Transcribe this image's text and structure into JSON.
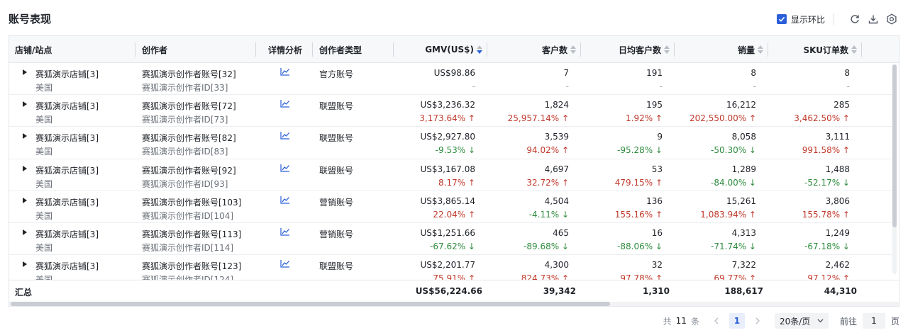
{
  "title": "账号表现",
  "toolbar": {
    "compare_label": "显示环比",
    "compare_checked": true,
    "icons": [
      "refresh-icon",
      "download-icon",
      "settings-icon"
    ]
  },
  "columns": {
    "shop": "店铺/站点",
    "creator": "创作者",
    "detail": "详情分析",
    "type": "创作者类型",
    "gmv": "GMV(US$)",
    "customers": "客户数",
    "daily": "日均客户数",
    "sales": "销量",
    "sku": "SKU订单数"
  },
  "rows": [
    {
      "shop": "赛狐演示店铺[3]",
      "site": "美国",
      "creator": "赛狐演示创作者账号[32]",
      "creator_id": "赛狐演示创作者ID[33]",
      "type": "官方账号",
      "gmv": "US$98.86",
      "gmv_chg": "-",
      "customers": "7",
      "customers_chg": "-",
      "daily": "191",
      "daily_chg": "-",
      "sales": "8",
      "sales_chg": "-",
      "sku": "8",
      "sku_chg": "-"
    },
    {
      "shop": "赛狐演示店铺[3]",
      "site": "美国",
      "creator": "赛狐演示创作者账号[72]",
      "creator_id": "赛狐演示创作者ID[73]",
      "type": "联盟账号",
      "gmv": "US$3,236.32",
      "gmv_chg": "3,173.64% ↑",
      "customers": "1,824",
      "customers_chg": "25,957.14% ↑",
      "daily": "195",
      "daily_chg": "1.92% ↑",
      "sales": "16,212",
      "sales_chg": "202,550.00% ↑",
      "sku": "285",
      "sku_chg": "3,462.50% ↑"
    },
    {
      "shop": "赛狐演示店铺[3]",
      "site": "美国",
      "creator": "赛狐演示创作者账号[82]",
      "creator_id": "赛狐演示创作者ID[83]",
      "type": "联盟账号",
      "gmv": "US$2,927.80",
      "gmv_chg": "-9.53% ↓",
      "customers": "3,539",
      "customers_chg": "94.02% ↑",
      "daily": "9",
      "daily_chg": "-95.28% ↓",
      "sales": "8,058",
      "sales_chg": "-50.30% ↓",
      "sku": "3,111",
      "sku_chg": "991.58% ↑"
    },
    {
      "shop": "赛狐演示店铺[3]",
      "site": "美国",
      "creator": "赛狐演示创作者账号[92]",
      "creator_id": "赛狐演示创作者ID[93]",
      "type": "联盟账号",
      "gmv": "US$3,167.08",
      "gmv_chg": "8.17% ↑",
      "customers": "4,697",
      "customers_chg": "32.72% ↑",
      "daily": "53",
      "daily_chg": "479.15% ↑",
      "sales": "1,289",
      "sales_chg": "-84.00% ↓",
      "sku": "1,488",
      "sku_chg": "-52.17% ↓"
    },
    {
      "shop": "赛狐演示店铺[3]",
      "site": "美国",
      "creator": "赛狐演示创作者账号[103]",
      "creator_id": "赛狐演示创作者ID[104]",
      "type": "营销账号",
      "gmv": "US$3,865.14",
      "gmv_chg": "22.04% ↑",
      "customers": "4,504",
      "customers_chg": "-4.11% ↓",
      "daily": "136",
      "daily_chg": "155.16% ↑",
      "sales": "15,261",
      "sales_chg": "1,083.94% ↑",
      "sku": "3,806",
      "sku_chg": "155.78% ↑"
    },
    {
      "shop": "赛狐演示店铺[3]",
      "site": "美国",
      "creator": "赛狐演示创作者账号[113]",
      "creator_id": "赛狐演示创作者ID[114]",
      "type": "营销账号",
      "gmv": "US$1,251.66",
      "gmv_chg": "-67.62% ↓",
      "customers": "465",
      "customers_chg": "-89.68% ↓",
      "daily": "16",
      "daily_chg": "-88.06% ↓",
      "sales": "4,313",
      "sales_chg": "-71.74% ↓",
      "sku": "1,249",
      "sku_chg": "-67.18% ↓"
    },
    {
      "shop": "赛狐演示店铺[3]",
      "site": "美国",
      "creator": "赛狐演示创作者账号[123]",
      "creator_id": "赛狐演示创作者ID[124]",
      "type": "联盟账号",
      "gmv": "US$2,201.77",
      "gmv_chg": "75.91% ↑",
      "customers": "4,300",
      "customers_chg": "824.73% ↑",
      "daily": "32",
      "daily_chg": "97.78% ↑",
      "sales": "7,322",
      "sales_chg": "69.77% ↑",
      "sku": "2,462",
      "sku_chg": "97.12% ↑"
    }
  ],
  "footer": {
    "label": "汇总",
    "gmv": "US$56,224.66",
    "customers": "39,342",
    "daily": "1,310",
    "sales": "188,617",
    "sku": "44,310"
  },
  "pagination": {
    "total_prefix": "共",
    "total": "11",
    "total_suffix": "条",
    "current_page": "1",
    "page_size": "20条/页",
    "goto_prefix": "前往",
    "goto_value": "1",
    "goto_suffix": "页"
  },
  "colors": {
    "accent": "#2b5fd9",
    "increase": "#c0392b",
    "decrease": "#2e8b3e"
  }
}
